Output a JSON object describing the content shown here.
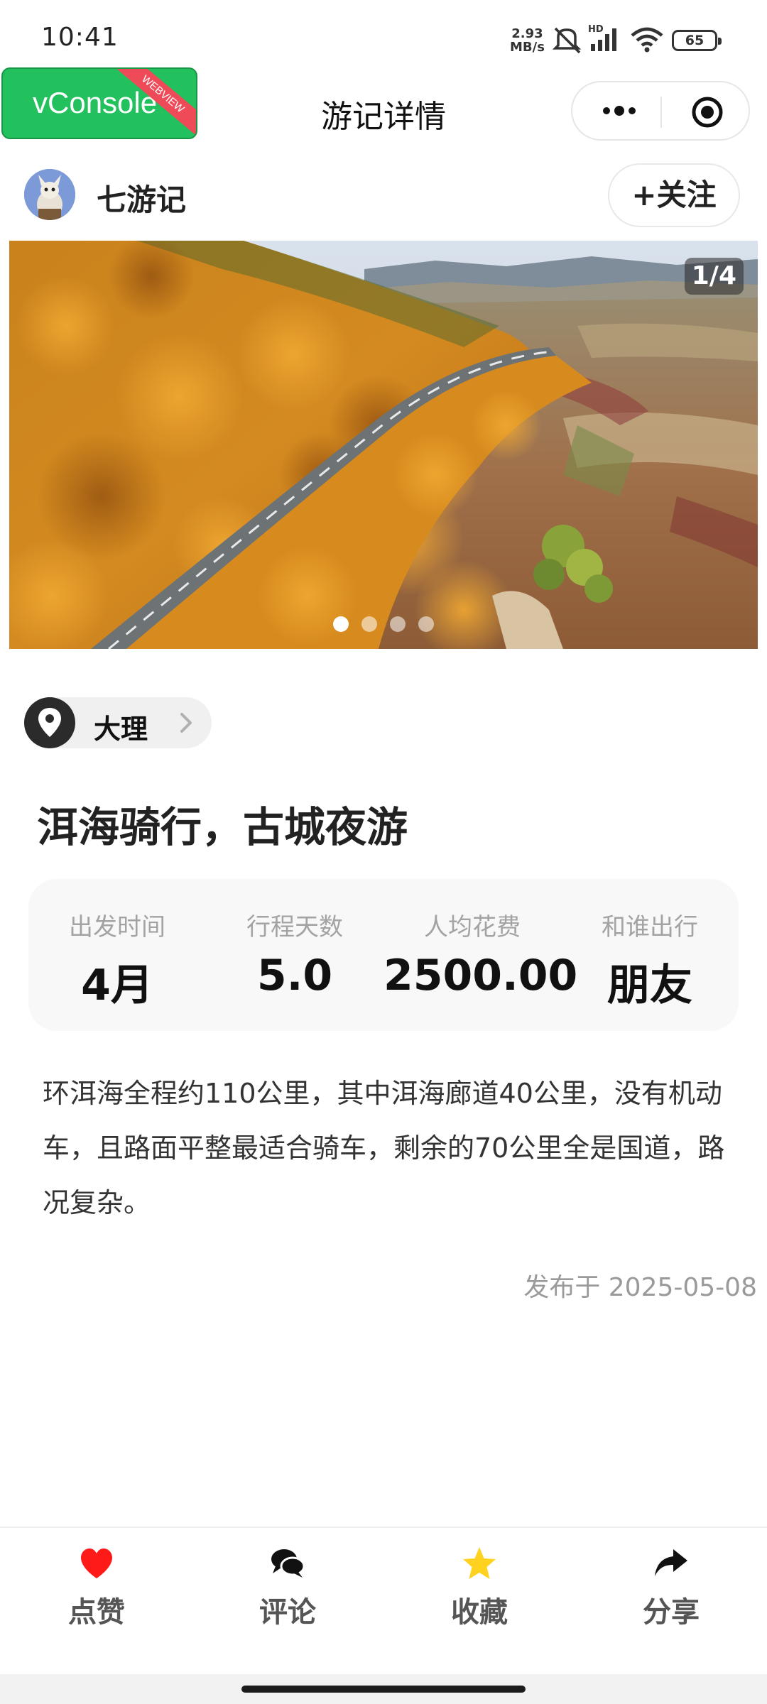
{
  "status_bar": {
    "time": "10:41",
    "net_speed_value": "2.93",
    "net_speed_unit": "MB/s",
    "hd_label": "HD",
    "battery": "65"
  },
  "vconsole": {
    "label": "vConsole",
    "ribbon": "WEBVIEW"
  },
  "nav": {
    "title": "游记详情"
  },
  "author": {
    "name": "七游记",
    "follow_label": "+关注"
  },
  "gallery": {
    "counter": "1/4",
    "total": 4,
    "current": 1
  },
  "location": {
    "name": "大理"
  },
  "post": {
    "title": "洱海骑行，古城夜游",
    "body": "环洱海全程约110公里，其中洱海廊道40公里，没有机动车，且路面平整最适合骑车，剩余的70公里全是国道，路况复杂。",
    "date": "发布于 2025-05-08"
  },
  "stats": [
    {
      "label": "出发时间",
      "value": "4月"
    },
    {
      "label": "行程天数",
      "value": "5.0"
    },
    {
      "label": "人均花费",
      "value": "2500.00"
    },
    {
      "label": "和谁出行",
      "value": "朋友"
    }
  ],
  "actions": [
    {
      "label": "点赞",
      "icon": "heart-icon",
      "color": "#ff1a1a"
    },
    {
      "label": "评论",
      "icon": "comment-icon",
      "color": "#111111"
    },
    {
      "label": "收藏",
      "icon": "star-icon",
      "color": "#ffd21f"
    },
    {
      "label": "分享",
      "icon": "share-icon",
      "color": "#111111"
    }
  ]
}
